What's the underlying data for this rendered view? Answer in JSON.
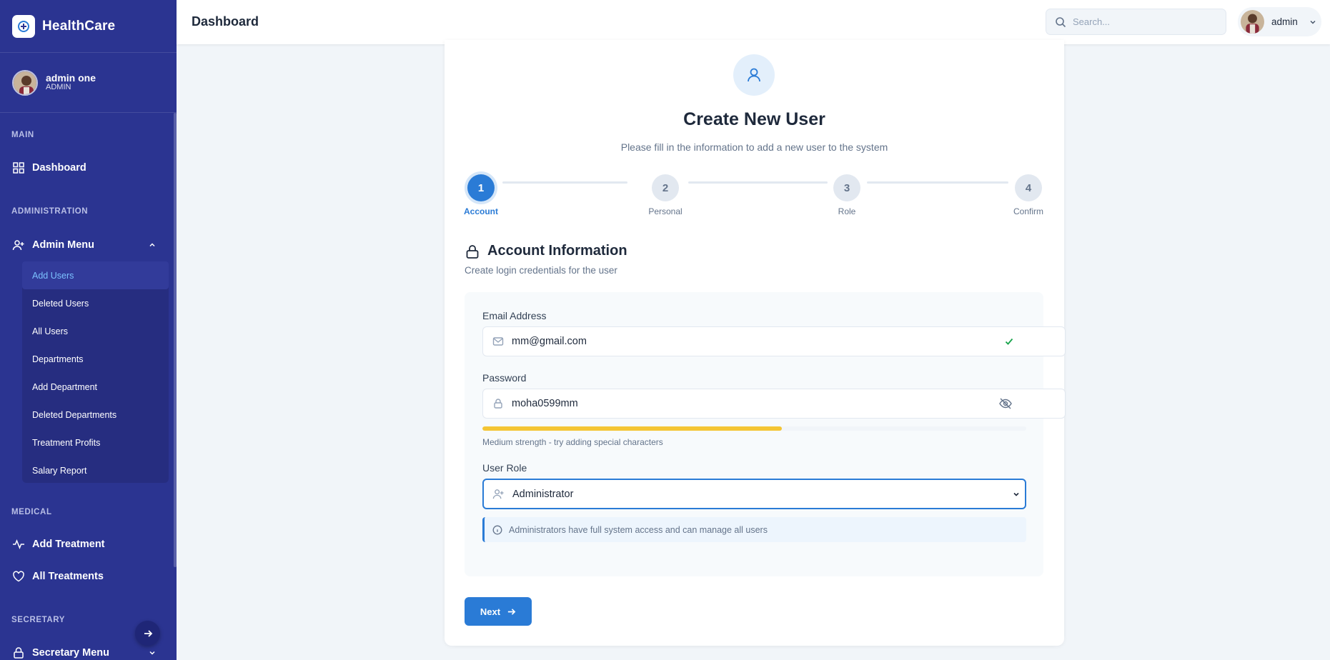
{
  "brand": {
    "name": "HealthCare"
  },
  "profile": {
    "name": "admin one",
    "role": "ADMIN"
  },
  "sidebar": {
    "sections": {
      "main": "MAIN",
      "administration": "ADMINISTRATION",
      "medical": "MEDICAL",
      "secretary": "SECRETARY"
    },
    "dashboard": "Dashboard",
    "admin_menu": "Admin Menu",
    "admin_items": [
      "Add Users",
      "Deleted Users",
      "All Users",
      "Departments",
      "Add Department",
      "Deleted Departments",
      "Treatment Profits",
      "Salary Report"
    ],
    "add_treatment": "Add Treatment",
    "all_treatments": "All Treatments",
    "secretary_menu": "Secretary Menu"
  },
  "header": {
    "title": "Dashboard",
    "search_placeholder": "Search...",
    "user": "admin"
  },
  "card": {
    "title": "Create New User",
    "subtitle": "Please fill in the information to add a new user to the system",
    "steps": [
      {
        "num": "1",
        "label": "Account"
      },
      {
        "num": "2",
        "label": "Personal"
      },
      {
        "num": "3",
        "label": "Role"
      },
      {
        "num": "4",
        "label": "Confirm"
      }
    ],
    "active_step": 1,
    "section_title": "Account Information",
    "section_sub": "Create login credentials for the user",
    "email_label": "Email Address",
    "email_value": "mm@gmail.com",
    "password_label": "Password",
    "password_value": "moha0599mm",
    "strength_fraction": 0.55,
    "strength_color": "#f4c534",
    "strength_text": "Medium strength - try adding special characters",
    "role_label": "User Role",
    "role_value": "Administrator",
    "info_text": "Administrators have full system access and can manage all users",
    "next_label": "Next"
  },
  "colors": {
    "sidebar": "#2b3491",
    "accent": "#2a7bd6",
    "success": "#16a34a"
  }
}
